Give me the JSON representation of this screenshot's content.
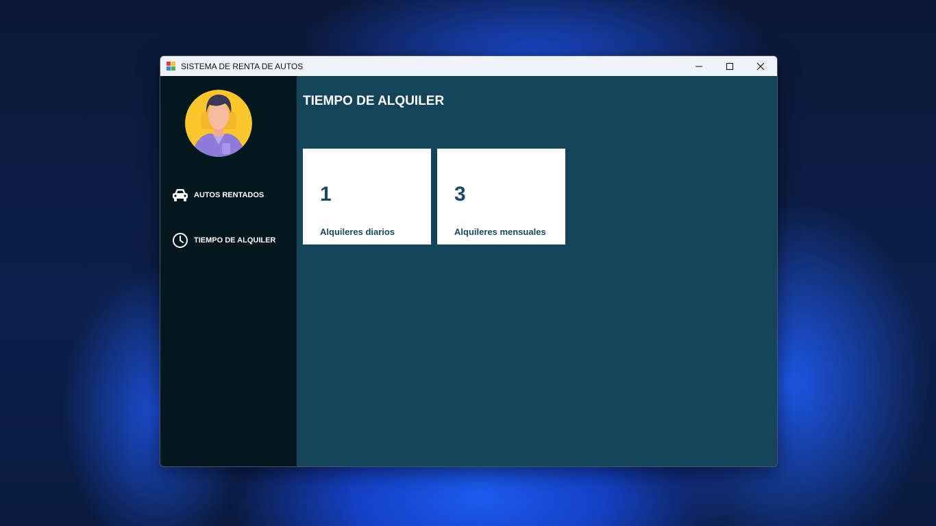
{
  "window": {
    "title": "SISTEMA DE RENTA DE AUTOS",
    "controls": {
      "minimize_icon": "minimize-icon",
      "maximize_icon": "maximize-icon",
      "close_icon": "close-icon"
    }
  },
  "sidebar": {
    "avatar": "user-avatar",
    "items": [
      {
        "label": "AUTOS RENTADOS",
        "icon": "car-icon"
      },
      {
        "label": "TIEMPO DE ALQUILER",
        "icon": "clock-icon"
      }
    ]
  },
  "main": {
    "title": "TIEMPO DE ALQUILER",
    "cards": [
      {
        "value": "1",
        "label": "Alquileres diarios"
      },
      {
        "value": "3",
        "label": "Alquileres mensuales"
      }
    ]
  },
  "colors": {
    "sidebar_bg": "#02171e",
    "main_bg": "#14445a",
    "card_bg": "#ffffff",
    "card_text": "#174a62",
    "titlebar_bg": "#f0f4fa"
  }
}
